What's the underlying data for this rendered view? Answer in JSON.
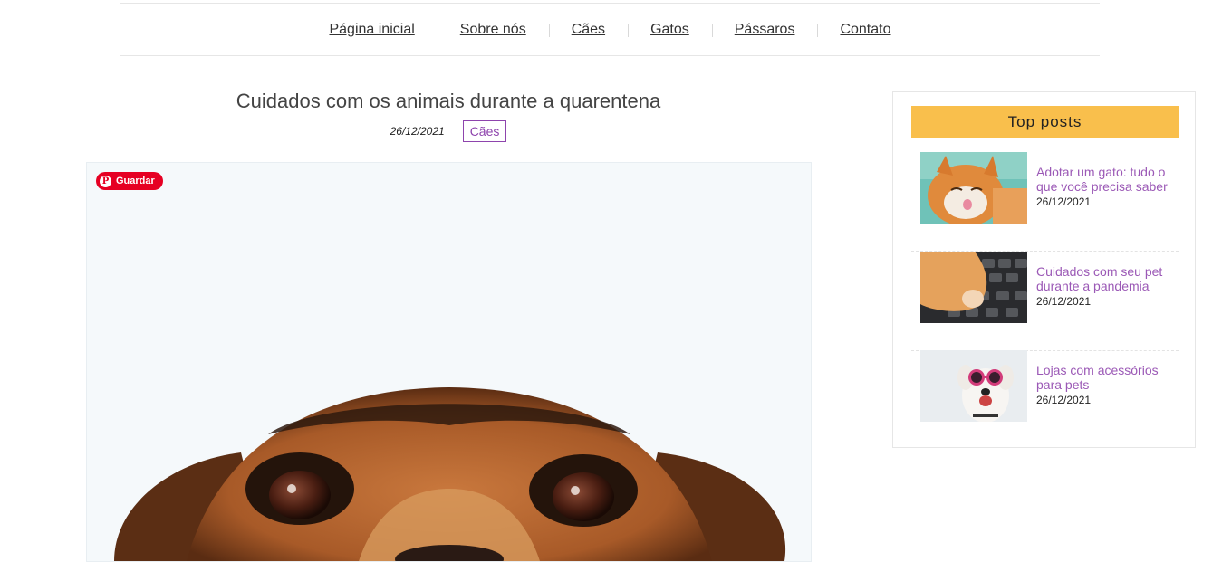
{
  "nav": {
    "items": [
      "Página inicial",
      "Sobre nós",
      "Cães",
      "Gatos",
      "Pássaros",
      "Contato"
    ]
  },
  "post": {
    "title": "Cuidados com os animais durante a quarentena",
    "date": "26/12/2021",
    "category": "Cães",
    "save_button": "Guardar"
  },
  "sidebar": {
    "title": "Top posts",
    "posts": [
      {
        "title": "Adotar um gato: tudo o que você precisa saber",
        "date": "26/12/2021",
        "image": "orange-cat-thumbnail"
      },
      {
        "title": "Cuidados com seu pet durante a pandemia",
        "date": "26/12/2021",
        "image": "cat-paw-on-keyboard-thumbnail"
      },
      {
        "title": "Lojas com acessórios para pets",
        "date": "26/12/2021",
        "image": "dog-with-sunglasses-thumbnail"
      }
    ]
  },
  "colors": {
    "accent_purple": "#8e44ad",
    "widget_yellow": "#f9bf4c",
    "pinterest_red": "#e60023"
  }
}
